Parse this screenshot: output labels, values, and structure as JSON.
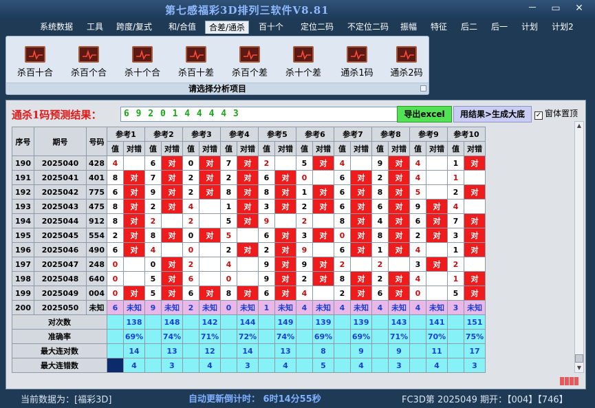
{
  "window": {
    "title": "第七感福彩3D排列三软件V8.81",
    "controls": [
      "－",
      "▭",
      "✕"
    ]
  },
  "menu": [
    {
      "label": "系统数据",
      "active": false
    },
    {
      "label": "工具",
      "active": false
    },
    {
      "label": "跨度/复式",
      "active": false
    },
    {
      "label": "和/合值",
      "active": false
    },
    {
      "label": "合差/通杀",
      "active": true
    },
    {
      "label": "百十个",
      "active": false
    },
    {
      "label": "定位二码",
      "active": false
    },
    {
      "label": "不定位二码",
      "active": false
    },
    {
      "label": "振幅",
      "active": false
    },
    {
      "label": "特征",
      "active": false
    },
    {
      "label": "后二",
      "active": false
    },
    {
      "label": "后一",
      "active": false
    },
    {
      "label": "计划",
      "active": false
    },
    {
      "label": "计划2",
      "active": false
    }
  ],
  "ribbon": {
    "buttons": [
      "杀百十合",
      "杀百个合",
      "杀十个合",
      "杀百十差",
      "杀百个差",
      "杀十个差",
      "通杀1码",
      "通杀2码"
    ],
    "icon": "chart-icon",
    "caption": "请选择分析项目"
  },
  "prediction": {
    "label": "通杀1码预测结果：",
    "value": "6 9 2 0 1 4 4 4 4 3",
    "export_button": "导出excel",
    "generate_button": "用结果>生成大底",
    "ontop_label": "窗体置顶",
    "ontop_checked": true
  },
  "table": {
    "headers": {
      "seq": "序号",
      "period": "期号",
      "number": "号码",
      "value": "值",
      "correct": "对错"
    },
    "refs": [
      "参考1",
      "参考2",
      "参考3",
      "参考4",
      "参考5",
      "参考6",
      "参考7",
      "参考8",
      "参考9",
      "参考10"
    ],
    "hit_mark": "对",
    "rows": [
      {
        "seq": "190",
        "period": "2025040",
        "number": "428",
        "values": [
          "4",
          "6",
          "0",
          "7",
          "2",
          "5",
          "4",
          "9",
          "4",
          "1"
        ],
        "hits": [
          0,
          1,
          1,
          1,
          0,
          1,
          0,
          1,
          0,
          1
        ],
        "red": [
          1,
          0,
          0,
          0,
          1,
          0,
          1,
          0,
          1,
          0
        ]
      },
      {
        "seq": "191",
        "period": "2025041",
        "number": "401",
        "values": [
          "8",
          "7",
          "2",
          "2",
          "6",
          "0",
          "6",
          "2",
          "4",
          "1"
        ],
        "hits": [
          1,
          1,
          1,
          1,
          1,
          0,
          1,
          1,
          0,
          0
        ],
        "red": [
          0,
          0,
          0,
          0,
          0,
          1,
          0,
          0,
          1,
          1
        ]
      },
      {
        "seq": "192",
        "period": "2025042",
        "number": "775",
        "values": [
          "6",
          "9",
          "2",
          "8",
          "8",
          "1",
          "6",
          "8",
          "5",
          "2"
        ],
        "hits": [
          1,
          1,
          1,
          1,
          1,
          1,
          1,
          1,
          0,
          1
        ],
        "red": [
          0,
          0,
          0,
          0,
          0,
          0,
          0,
          0,
          1,
          0
        ]
      },
      {
        "seq": "193",
        "period": "2025043",
        "number": "475",
        "values": [
          "8",
          "2",
          "4",
          "1",
          "3",
          "2",
          "6",
          "6",
          "9",
          "4"
        ],
        "hits": [
          1,
          1,
          0,
          1,
          1,
          1,
          1,
          1,
          1,
          0
        ],
        "red": [
          0,
          0,
          1,
          0,
          0,
          0,
          0,
          0,
          0,
          1
        ]
      },
      {
        "seq": "194",
        "period": "2025044",
        "number": "912",
        "values": [
          "8",
          "2",
          "2",
          "5",
          "9",
          "2",
          "8",
          "4",
          "6",
          "7"
        ],
        "hits": [
          1,
          0,
          0,
          1,
          0,
          0,
          1,
          1,
          1,
          1
        ],
        "red": [
          0,
          1,
          1,
          0,
          1,
          1,
          0,
          0,
          0,
          0
        ]
      },
      {
        "seq": "195",
        "period": "2025045",
        "number": "554",
        "values": [
          "2",
          "8",
          "0",
          "5",
          "6",
          "3",
          "0",
          "8",
          "2",
          "3"
        ],
        "hits": [
          1,
          1,
          1,
          0,
          1,
          1,
          1,
          1,
          1,
          1
        ],
        "red": [
          0,
          0,
          0,
          1,
          0,
          0,
          1,
          0,
          0,
          0
        ]
      },
      {
        "seq": "196",
        "period": "2025046",
        "number": "490",
        "values": [
          "6",
          "4",
          "0",
          "2",
          "2",
          "9",
          "6",
          "1",
          "4",
          "1"
        ],
        "hits": [
          1,
          0,
          0,
          1,
          1,
          0,
          1,
          1,
          0,
          1
        ],
        "red": [
          0,
          1,
          1,
          0,
          0,
          1,
          0,
          0,
          1,
          0
        ]
      },
      {
        "seq": "197",
        "period": "2025047",
        "number": "248",
        "values": [
          "0",
          "0",
          "2",
          "4",
          "9",
          "9",
          "2",
          "2",
          "3",
          "2"
        ],
        "hits": [
          0,
          1,
          0,
          0,
          1,
          1,
          0,
          0,
          1,
          0
        ],
        "red": [
          1,
          0,
          1,
          1,
          0,
          0,
          1,
          1,
          0,
          1
        ]
      },
      {
        "seq": "198",
        "period": "2025048",
        "number": "640",
        "values": [
          "0",
          "5",
          "6",
          "0",
          "9",
          "2",
          "8",
          "2",
          "4",
          "1"
        ],
        "hits": [
          0,
          1,
          0,
          0,
          1,
          1,
          1,
          1,
          0,
          1
        ],
        "red": [
          1,
          0,
          1,
          1,
          0,
          0,
          0,
          0,
          1,
          1
        ]
      },
      {
        "seq": "199",
        "period": "2025049",
        "number": "004",
        "values": [
          "0",
          "5",
          "6",
          "8",
          "6",
          "4",
          "2",
          "6",
          "0",
          "5"
        ],
        "hits": [
          1,
          1,
          1,
          1,
          1,
          0,
          1,
          1,
          0,
          1
        ],
        "red": [
          1,
          0,
          0,
          0,
          0,
          1,
          0,
          0,
          1,
          0
        ]
      },
      {
        "seq": "200",
        "period": "2025050",
        "number": "未知",
        "values": [
          "6",
          "9",
          "2",
          "0",
          "1",
          "4",
          "4",
          "4",
          "4",
          "3"
        ],
        "hits": [],
        "red": [],
        "unknown_label": "未知"
      }
    ],
    "stats": [
      {
        "label": "对次数",
        "values": [
          "138",
          "148",
          "142",
          "144",
          "149",
          "139",
          "139",
          "143",
          "141",
          "151"
        ]
      },
      {
        "label": "准确率",
        "values": [
          "69%",
          "74%",
          "71%",
          "72%",
          "74%",
          "69%",
          "69%",
          "71%",
          "70%",
          "75%"
        ]
      },
      {
        "label": "最大连对数",
        "values": [
          "14",
          "13",
          "12",
          "14",
          "13",
          "8",
          "9",
          "9",
          "11",
          "17"
        ]
      },
      {
        "label": "最大连错数",
        "values": [
          "4",
          "3",
          "4",
          "3",
          "4",
          "5",
          "4",
          "3",
          "4",
          "3"
        ]
      }
    ]
  },
  "status": {
    "data_source": "当前数据为：[福彩3D]",
    "countdown": "自动更新倒计时：  6时14分55秒",
    "issue": "FC3D第 2025049 期开：【004】【746】"
  }
}
